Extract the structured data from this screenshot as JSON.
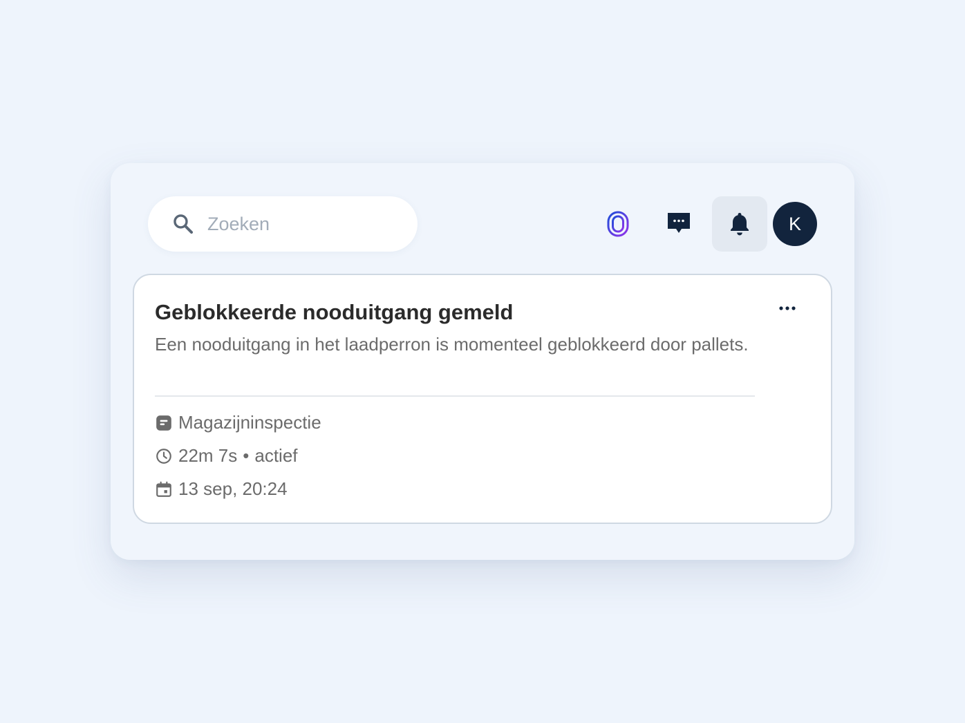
{
  "search": {
    "placeholder": "Zoeken",
    "icon": "search-icon"
  },
  "toolbar": {
    "icons": [
      "fingerprint-logo-icon",
      "chat-icon",
      "bell-icon"
    ],
    "avatar_initial": "K",
    "logo_gradient": [
      "#1d4ed8",
      "#9333ea"
    ]
  },
  "card": {
    "title": "Geblokkeerde nooduitgang gemeld",
    "description": "Een nooduitgang in het laadperron is momenteel geblokkeerd door pallets.",
    "category": "Magazijninspectie",
    "duration": "22m 7s",
    "status_separator": "•",
    "status": "actief",
    "datetime": "13 sep, 20:24",
    "meta_icons": [
      "tag-icon",
      "clock-icon",
      "calendar-icon"
    ]
  },
  "colors": {
    "background": "#eef4fc",
    "panel": "#f0f5fc",
    "avatar": "#12243d",
    "icon_dark": "#12243d"
  }
}
